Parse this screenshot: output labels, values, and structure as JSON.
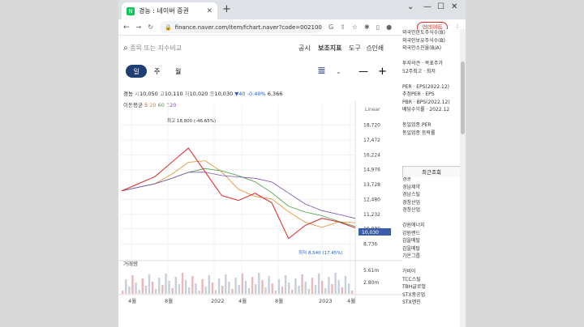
{
  "browser": {
    "tab_title": "경농 : 네이버 증권",
    "tab_favicon": "N",
    "url": "finance.naver.com/item/fchart.naver?code=002100",
    "update_button": "업데이트"
  },
  "toolbar": {
    "search_placeholder": "종목 또는 지수비교",
    "items": [
      "공시",
      "보조지표",
      "도구",
      "인쇄"
    ]
  },
  "periods": [
    "일",
    "주",
    "월"
  ],
  "quote": {
    "name": "경농",
    "open_label": "시",
    "open": "10,050",
    "high_label": "고",
    "high": "10,110",
    "low_label": "저",
    "low": "10,020",
    "close_label": "종",
    "close": "10,030",
    "change": "▼40",
    "change_pct": "-0.40%",
    "volume": "6,366"
  },
  "moving_avg": {
    "label": "이동평균",
    "v1": "5",
    "v2": "20",
    "v3": "60",
    "v4": "120",
    "colors": [
      "#e03a3a",
      "#e38b2b",
      "#3f9a3f",
      "#7a4fb5"
    ]
  },
  "chart_data": {
    "type": "line",
    "title": "",
    "scale": "Linear",
    "y_ticks": [
      "18,720",
      "17,472",
      "16,224",
      "14,976",
      "13,728",
      "12,480",
      "11,232",
      "10,030",
      "8,736"
    ],
    "x_ticks": [
      "4월",
      "8월",
      "2022",
      "4월",
      "8월",
      "2023",
      "4월"
    ],
    "high_annotation": "최고 18,800 (-46.65%)",
    "low_annotation": "최저 8,540 (17.45%)",
    "current_price": "10,030",
    "x": [
      "2021-03",
      "2021-05",
      "2021-07",
      "2021-08",
      "2021-10",
      "2021-12",
      "2022-02",
      "2022-04",
      "2022-06",
      "2022-08",
      "2022-09",
      "2022-11",
      "2023-01",
      "2023-03",
      "2023-05"
    ],
    "series": [
      {
        "values": [
          13200,
          13800,
          14400,
          15600,
          16800,
          14800,
          12800,
          12400,
          13000,
          12200,
          9200,
          10300,
          10900,
          10600,
          10100
        ]
      }
    ],
    "volume": {
      "label": "거래량",
      "ticks": [
        "5.61m",
        "2.80m"
      ]
    }
  },
  "sidebar": {
    "top": [
      "외국인한도주식수(B)",
      "외국인보유주식수(B)",
      "외국인소진율(B/A)",
      "",
      "투자의견 · 목표주가",
      "52주최고 · 최저",
      "",
      "PER · EPS(2022.12)",
      "추정PER · EPS",
      "PBR · BPS(2022.12)",
      "배당수익률 · 2022.12",
      "",
      "동일업종 PER",
      "동일업종 등락률"
    ],
    "recent_label": "최근조회",
    "list": [
      "경농",
      "경남제약",
      "경남스틸",
      "경창산업",
      "경창산업",
      "",
      "강원에너지",
      "강원랜드",
      "갑을메탈",
      "갑을메탈",
      "가온그룹",
      "",
      "가비아",
      "TCC스틸",
      "TBH글로벌",
      "STX중공업",
      "STX엔진"
    ]
  }
}
